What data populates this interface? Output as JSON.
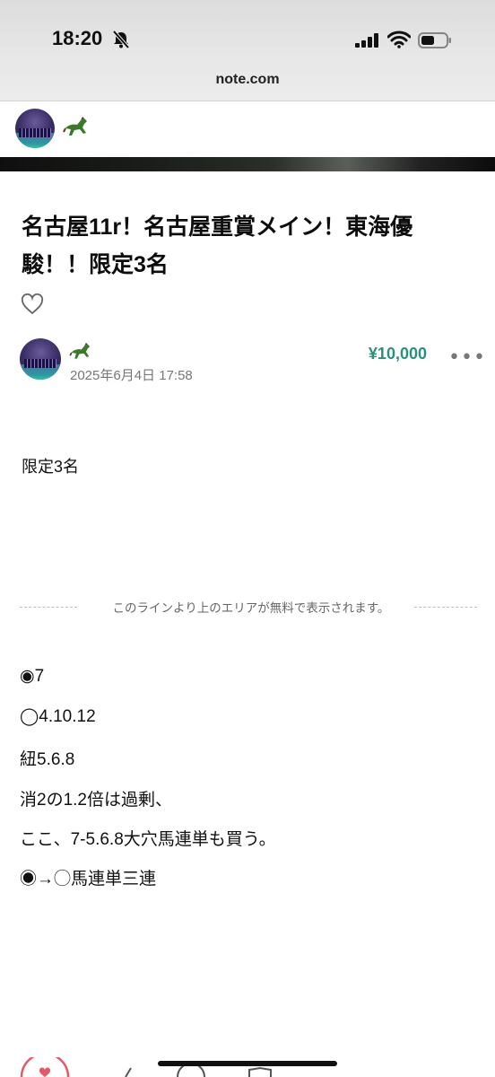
{
  "status_bar": {
    "time": "18:20",
    "url": "note.com"
  },
  "creator": {
    "avatar_icon": "avatar-city-night",
    "name_icon": "horse-emoji"
  },
  "article": {
    "title": "名古屋11r！名古屋重賞メイン！東海優駿！！限定3名",
    "price": "¥10,000",
    "more_label": "•••",
    "published": "2025年6月4日 17:58",
    "free_text": "限定3名",
    "paywall_notice": "このラインより上のエリアが無料で表示されます。",
    "lines": [
      "◉7",
      "◯4.10.12",
      "紐5.6.8",
      "消2の1.2倍は過剰、",
      "ここ、7-5.6.8大穴馬連単も買う。",
      "◉→◯馬連単三連"
    ]
  },
  "colors": {
    "price": "#2c8f7c",
    "like": "#e05a6a",
    "text": "#111111",
    "muted": "#777777"
  }
}
